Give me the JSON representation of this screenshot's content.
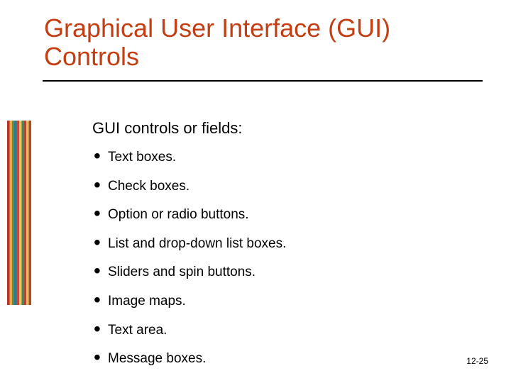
{
  "title": "Graphical User Interface (GUI) Controls",
  "body": {
    "lead": "GUI controls or fields:",
    "items": [
      "Text boxes.",
      "Check boxes.",
      "Option or radio buttons.",
      "List and drop-down list boxes.",
      "Sliders and spin buttons.",
      "Image maps.",
      "Text area.",
      "Message boxes."
    ]
  },
  "footer": "12-25"
}
